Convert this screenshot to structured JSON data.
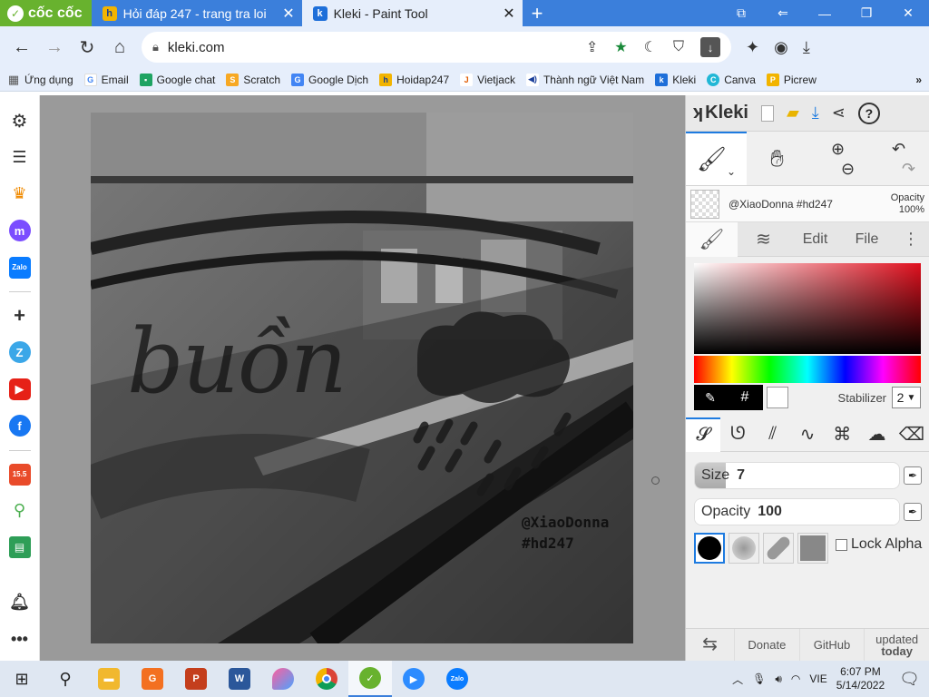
{
  "browser": {
    "brand": "cốc cốc",
    "tabs": [
      {
        "label": "Hỏi đáp 247 - trang tra loi",
        "active": false
      },
      {
        "label": "Kleki - Paint Tool",
        "active": true
      }
    ],
    "url": "kleki.com"
  },
  "bookmarks": [
    {
      "label": "Ứng dụng",
      "icon": "apps-grid-icon"
    },
    {
      "label": "Email",
      "icon": "google-icon"
    },
    {
      "label": "Google chat",
      "icon": "chat-icon"
    },
    {
      "label": "Scratch",
      "icon": "scratch-icon"
    },
    {
      "label": "Google Dịch",
      "icon": "translate-icon"
    },
    {
      "label": "Hoidap247",
      "icon": "hoidap-icon"
    },
    {
      "label": "Vietjack",
      "icon": "vietjack-icon"
    },
    {
      "label": "Thành ngữ Việt Nam",
      "icon": "speaker-icon"
    },
    {
      "label": "Kleki",
      "icon": "kleki-icon"
    },
    {
      "label": "Canva",
      "icon": "canva-icon"
    },
    {
      "label": "Picrew",
      "icon": "picrew-icon"
    }
  ],
  "bookmarks_more": "»",
  "canvas": {
    "lettering": "buồn",
    "signature_line1": "@XiaoDonna",
    "signature_line2": "#hd247"
  },
  "kleki": {
    "logo": "Kleki",
    "layer_name": "@XiaoDonna #hd247",
    "layer_opacity_label": "Opacity",
    "layer_opacity_value": "100%",
    "tabs": [
      "Edit",
      "File"
    ],
    "hex_label": "#",
    "stabilizer_label": "Stabilizer",
    "stabilizer_value": "2",
    "size_label": "Size",
    "size_value": "7",
    "size_fraction": 0.15,
    "opacity_label": "Opacity",
    "opacity_value": "100",
    "opacity_fraction": 1.0,
    "lock_alpha_label": "Lock Alpha",
    "footer": {
      "donate": "Donate",
      "github": "GitHub",
      "updated_line1": "updated",
      "updated_line2": "today"
    }
  },
  "taskbar": {
    "language": "VIE",
    "time": "6:07 PM",
    "date": "5/14/2022"
  }
}
